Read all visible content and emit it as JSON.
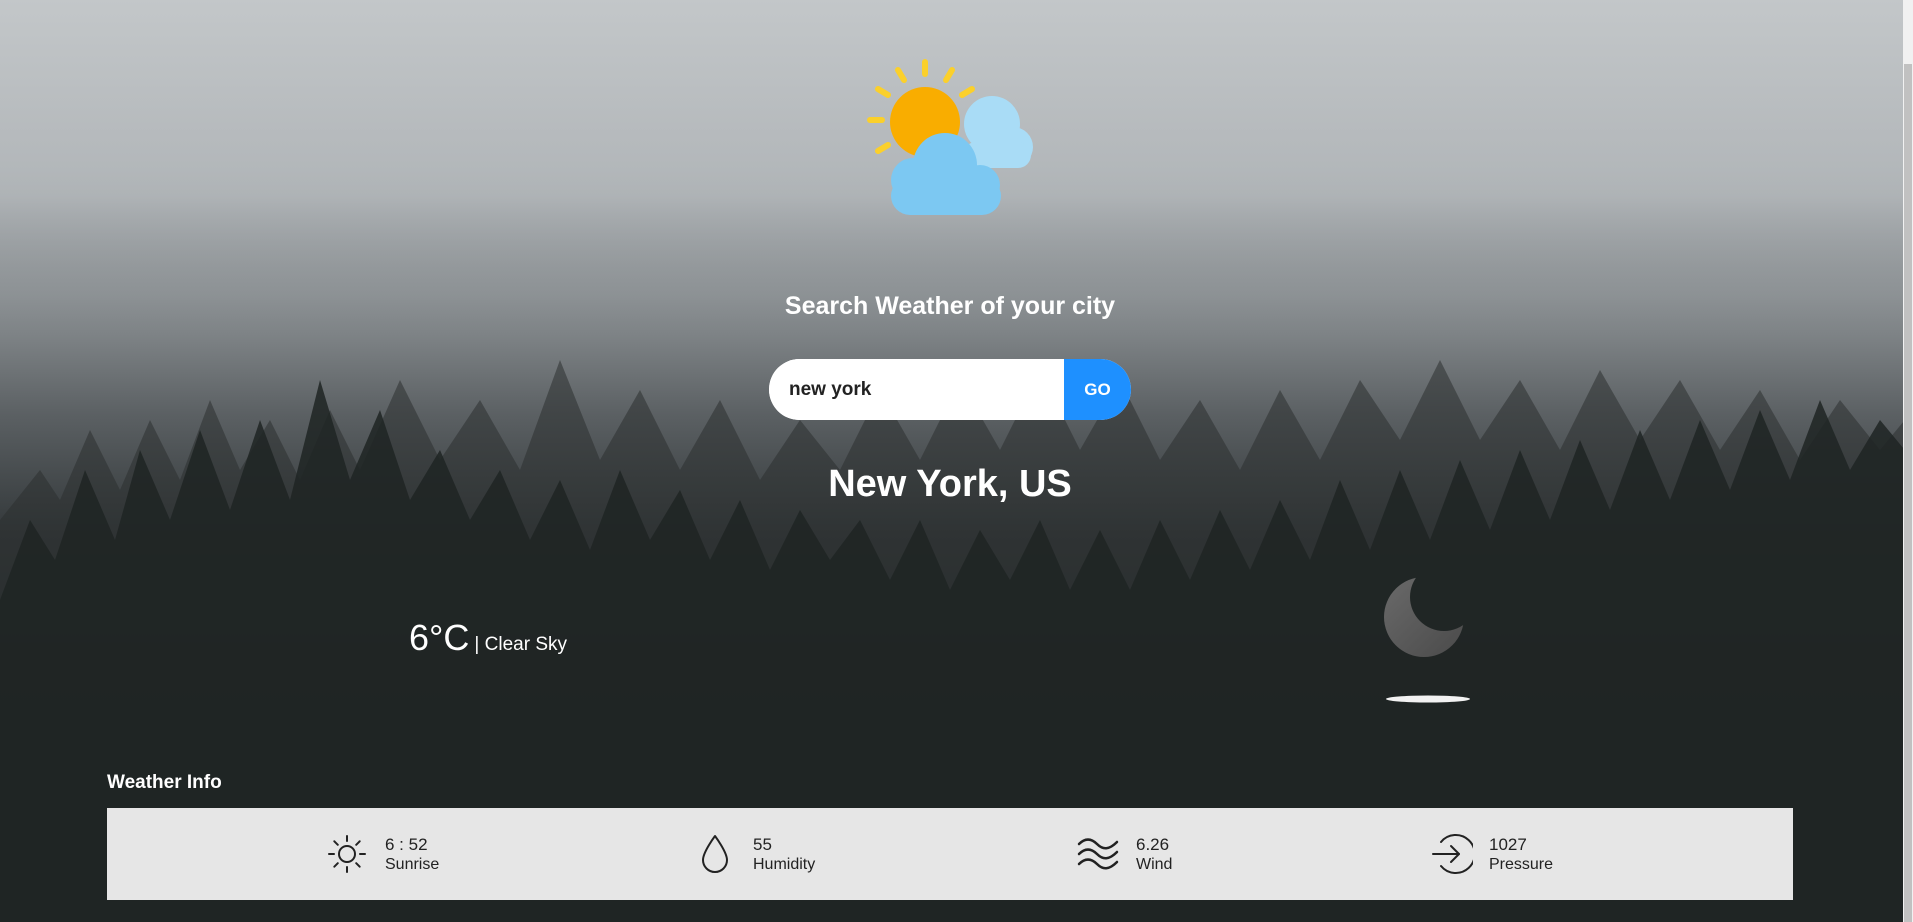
{
  "app": {
    "heading": "Search Weather of your city"
  },
  "search": {
    "value": "new york",
    "button_label": "GO"
  },
  "location": {
    "name": "New York, US"
  },
  "current": {
    "temperature": "6°C",
    "description": "| Clear Sky",
    "condition_icon": "moon-icon"
  },
  "weather_info": {
    "title": "Weather Info",
    "items": [
      {
        "icon": "sunrise-icon",
        "value": "6 : 52",
        "label": "Sunrise"
      },
      {
        "icon": "humidity-icon",
        "value": "55",
        "label": "Humidity"
      },
      {
        "icon": "wind-icon",
        "value": "6.26",
        "label": "Wind"
      },
      {
        "icon": "pressure-icon",
        "value": "1027",
        "label": "Pressure"
      }
    ]
  },
  "colors": {
    "accent": "#1e90ff",
    "sun": "#f9ad00",
    "sun_rays": "#fbd02b",
    "cloud": "#7cc8f2",
    "cloud_back": "#a9dcf6",
    "info_bar": "#e6e6e6"
  }
}
